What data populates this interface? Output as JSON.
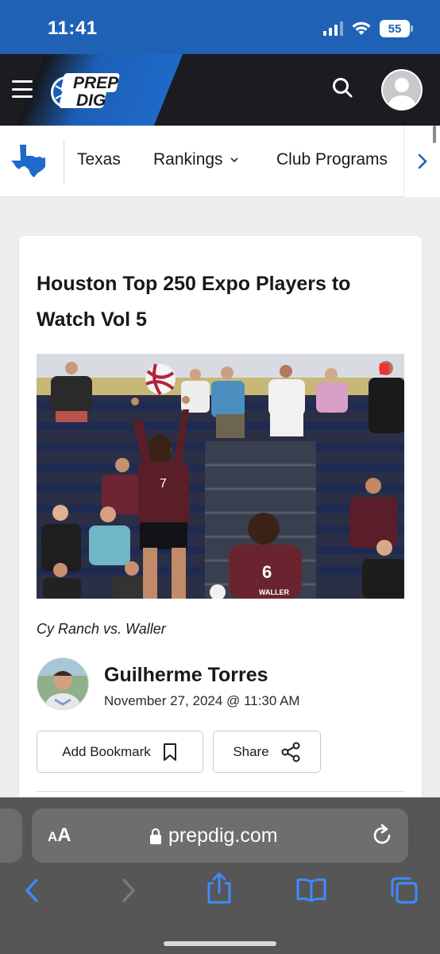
{
  "status_bar": {
    "time": "11:41",
    "battery": "55"
  },
  "header": {
    "logo_line1": "PREP",
    "logo_line2": "DIG"
  },
  "subnav": {
    "items": [
      {
        "label": "Texas"
      },
      {
        "label": "Rankings"
      },
      {
        "label": "Club Programs"
      }
    ]
  },
  "article": {
    "title": "Houston Top 250 Expo Players to Watch Vol 5",
    "caption": "Cy Ranch vs. Waller",
    "photo": {
      "player1_number": "7",
      "player2_number": "6",
      "player2_jersey_text": "WALLER"
    },
    "author": {
      "name": "Guilherme Torres",
      "date": "November 27, 2024 @ 11:30 AM"
    },
    "actions": {
      "bookmark_label": "Add Bookmark",
      "share_label": "Share"
    }
  },
  "browser": {
    "aa_small": "A",
    "aa_big": "A",
    "url": "prepdig.com"
  },
  "colors": {
    "brand_blue": "#1f62b5",
    "header_dark": "#1b1c20",
    "safari_bar": "#565656"
  }
}
